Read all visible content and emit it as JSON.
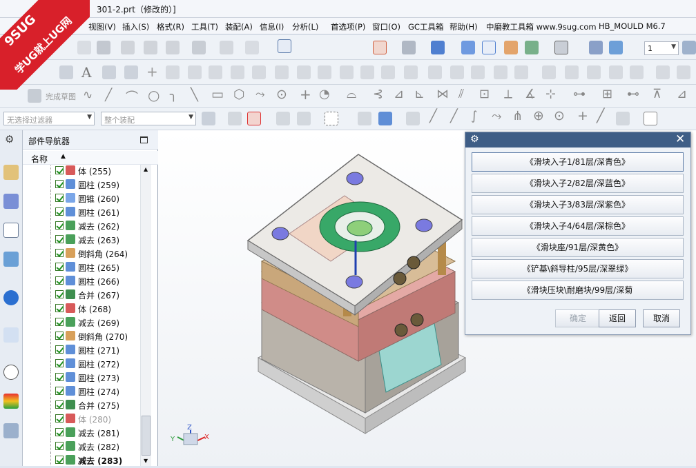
{
  "window": {
    "title": "301-2.prt（修改的）]"
  },
  "logo": {
    "brand": "9SUG",
    "slogan": "学UG就上UG网"
  },
  "menu": [
    "视图(V)",
    "插入(S)",
    "格式(R)",
    "工具(T)",
    "装配(A)",
    "信息(I)",
    "分析(L)",
    "首选项(P)",
    "窗口(O)",
    "GC工具箱",
    "帮助(H)",
    "中磨教工具箱 www.9sug.com",
    "HB_MOULD M6.7"
  ],
  "toolbar": {
    "layer_value": "1",
    "sketch_label": "完成草图",
    "filter_placeholder": "无选择过滤器",
    "assembly_placeholder": "整个装配"
  },
  "navigator": {
    "title": "部件导航器",
    "column_header": "名称",
    "rows": [
      {
        "label": "体 (255)",
        "icon": "body"
      },
      {
        "label": "圆柱 (259)",
        "icon": "cylinder"
      },
      {
        "label": "圆锥 (260)",
        "icon": "cone"
      },
      {
        "label": "圆柱 (261)",
        "icon": "cylinder"
      },
      {
        "label": "减去 (262)",
        "icon": "subtract"
      },
      {
        "label": "减去 (263)",
        "icon": "subtract"
      },
      {
        "label": "倒斜角 (264)",
        "icon": "chamfer"
      },
      {
        "label": "圆柱 (265)",
        "icon": "cylinder"
      },
      {
        "label": "圆柱 (266)",
        "icon": "cylinder"
      },
      {
        "label": "合并 (267)",
        "icon": "unite"
      },
      {
        "label": "体 (268)",
        "icon": "body"
      },
      {
        "label": "减去 (269)",
        "icon": "subtract"
      },
      {
        "label": "倒斜角 (270)",
        "icon": "chamfer"
      },
      {
        "label": "圆柱 (271)",
        "icon": "cylinder"
      },
      {
        "label": "圆柱 (272)",
        "icon": "cylinder"
      },
      {
        "label": "圆柱 (273)",
        "icon": "cylinder"
      },
      {
        "label": "圆柱 (274)",
        "icon": "cylinder"
      },
      {
        "label": "合并 (275)",
        "icon": "unite"
      },
      {
        "label": "体 (280)",
        "icon": "body",
        "dimmed": true
      },
      {
        "label": "减去 (281)",
        "icon": "subtract"
      },
      {
        "label": "减去 (282)",
        "icon": "subtract"
      },
      {
        "label": "减去 (283)",
        "icon": "subtract",
        "bold": true
      }
    ]
  },
  "dialog": {
    "buttons": [
      "《滑块入子1/81层/深青色》",
      "《滑块入子2/82层/深蓝色》",
      "《滑块入子3/83层/深紫色》",
      "《滑块入子4/64层/深棕色》",
      "《滑块座/91层/深黄色》",
      "《铲基\\斜导柱/95层/深翠绿》",
      "《滑块压块\\耐磨块/99层/深菊"
    ],
    "ok_label": "确定",
    "back_label": "返回",
    "cancel_label": "取消"
  },
  "triad": {
    "x": "X",
    "y": "Y",
    "z": "Z"
  },
  "colors": {
    "accent": "#3f5e86",
    "logo_red": "#d8202a",
    "check_green": "#1f8f1f"
  }
}
